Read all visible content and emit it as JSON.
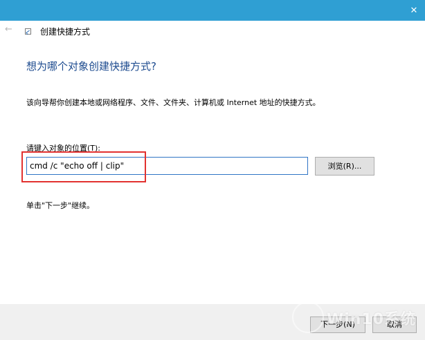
{
  "window": {
    "title": "创建快捷方式",
    "close_glyph": "✕",
    "back_glyph": "←"
  },
  "main": {
    "heading": "想为哪个对象创建快捷方式?",
    "description": "该向导帮你创建本地或网络程序、文件、文件夹、计算机或 Internet 地址的快捷方式。",
    "location_label": "请键入对象的位置(T):",
    "location_value": "cmd /c \"echo off | clip\"",
    "browse_label": "浏览(R)...",
    "hint": "单击\"下一步\"继续。"
  },
  "footer": {
    "next_label": "下一步(N)",
    "cancel_label": "取消"
  },
  "watermark": {
    "text": "Win10系统"
  },
  "colors": {
    "titlebar": "#2f9fd3",
    "heading": "#1d4b8f",
    "highlight": "#e2312f",
    "input_border": "#2f74c5"
  }
}
